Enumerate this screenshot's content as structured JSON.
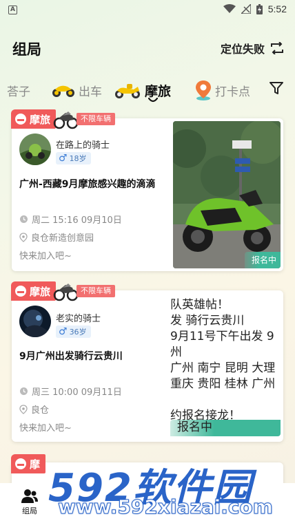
{
  "status_bar": {
    "time": "5:52"
  },
  "header": {
    "title": "组局",
    "location": "定位失败"
  },
  "tabs": [
    {
      "label": "荅子"
    },
    {
      "label": "出车"
    },
    {
      "label": "摩旅"
    },
    {
      "label": "打卡点"
    }
  ],
  "cards": [
    {
      "badge": "摩旅",
      "sub_badge": "不限车辆",
      "user": "在路上的骑士",
      "age": "18岁",
      "title": "广州-西藏9月摩旅感兴趣的滴滴",
      "time": "周二 15:16 09月10日",
      "place": "良仓新造创意园",
      "join": "快来加入吧~",
      "status": "报名中"
    },
    {
      "badge": "摩旅",
      "sub_badge": "不限车辆",
      "user": "老实的骑士",
      "age": "36岁",
      "title": "9月广州出发骑行云贵川",
      "time": "周三 10:00 09月11日",
      "place": "良仓",
      "join": "快来加入吧~",
      "status": "报名中",
      "image_text": [
        "队英雄帖！",
        "发 骑行云贵川",
        "9月11号下午出发 9",
        "州",
        "广州 南宁 昆明 大理",
        " 重庆 贵阳 桂林 广州",
        "",
        "约报名接龙！"
      ]
    },
    {
      "badge": "摩"
    }
  ],
  "bottom_nav": {
    "label": "组局"
  },
  "watermark": {
    "brand": "592软件园",
    "url": "www.592xiazai.com"
  },
  "colors": {
    "badge_red": "#f05a5a",
    "status_green": "#3fb89a",
    "age_blue": "#3a7bd5"
  }
}
